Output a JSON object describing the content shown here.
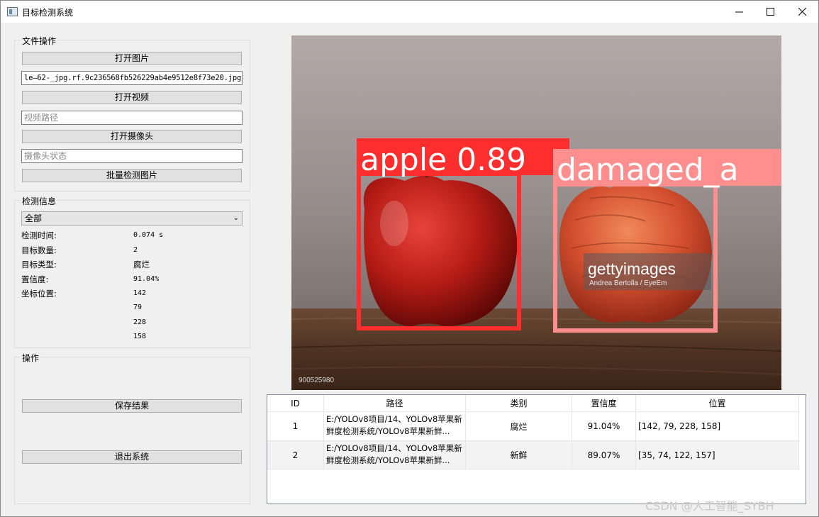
{
  "window": {
    "title": "目标检测系统",
    "minimize_icon": "minimize-icon",
    "maximize_icon": "maximize-icon",
    "close_icon": "close-icon"
  },
  "file_ops": {
    "title": "文件操作",
    "open_image_label": "打开图片",
    "image_path_value": "le—62-_jpg.rf.9c236568fb526229ab4e9512e8f73e20.jpg",
    "open_video_label": "打开视频",
    "video_path_placeholder": "视频路径",
    "open_camera_label": "打开摄像头",
    "camera_status_placeholder": "摄像头状态",
    "batch_detect_label": "批量检测图片"
  },
  "detect_info": {
    "title": "检测信息",
    "filter_selected": "全部",
    "time_label": "检测时间:",
    "time_value": "0.074 s",
    "count_label": "目标数量:",
    "count_value": "2",
    "type_label": "目标类型:",
    "type_value": "腐烂",
    "conf_label": "置信度:",
    "conf_value": "91.04%",
    "pos_label": "坐标位置:",
    "pos_values": [
      "142",
      "79",
      "228",
      "158"
    ]
  },
  "actions": {
    "title": "操作",
    "save_label": "保存结果",
    "exit_label": "退出系统"
  },
  "image": {
    "box1_label": "apple 0.89",
    "box2_label": "damaged_a",
    "getty_brand": "gettyimages",
    "getty_credit": "Andrea Bertolla / EyeEm",
    "getty_id": "900525980",
    "box1_color": "#ff2e2e",
    "box2_color": "#ff8f8f"
  },
  "table": {
    "headers": [
      "ID",
      "路径",
      "类别",
      "置信度",
      "位置"
    ],
    "rows": [
      {
        "id": "1",
        "path": "E:/YOLOv8项目/14、YOLOv8苹果新鲜度检测系统/YOLOv8苹果新鲜...",
        "category": "腐烂",
        "confidence": "91.04%",
        "position": "[142, 79, 228, 158]"
      },
      {
        "id": "2",
        "path": "E:/YOLOv8项目/14、YOLOv8苹果新鲜度检测系统/YOLOv8苹果新鲜...",
        "category": "新鲜",
        "confidence": "89.07%",
        "position": "[35, 74, 122, 157]"
      }
    ]
  },
  "watermark": "CSDN @人工智能_SYBH"
}
